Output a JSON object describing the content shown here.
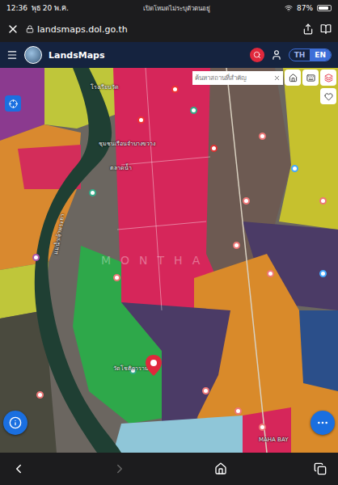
{
  "status_bar": {
    "time": "12:36",
    "date": "พุธ 20 พ.ค.",
    "center": "เปิดโหมดไม่ระบุตัวตนอยู่",
    "battery": "87%",
    "battery_level": 0.87
  },
  "browser": {
    "url": "landsmaps.dol.go.th"
  },
  "app_header": {
    "title": "LandsMaps",
    "languages": [
      {
        "label": "TH",
        "selected": false
      },
      {
        "label": "EN",
        "selected": true
      }
    ]
  },
  "map": {
    "search": {
      "placeholder": "ค้นหาสถานที่สำคัญ"
    },
    "watermark": "MONTHA",
    "labels": [
      {
        "text": "โรงเรียนวัด"
      },
      {
        "text": "ชุมชนเรือนจำบางขวาง"
      },
      {
        "text": "ตลาดน้ำ"
      },
      {
        "text": "แม่น้ำเจ้าพระยา"
      },
      {
        "text": "วัดโชติการาม"
      },
      {
        "text": "MAHA BAY"
      }
    ]
  }
}
